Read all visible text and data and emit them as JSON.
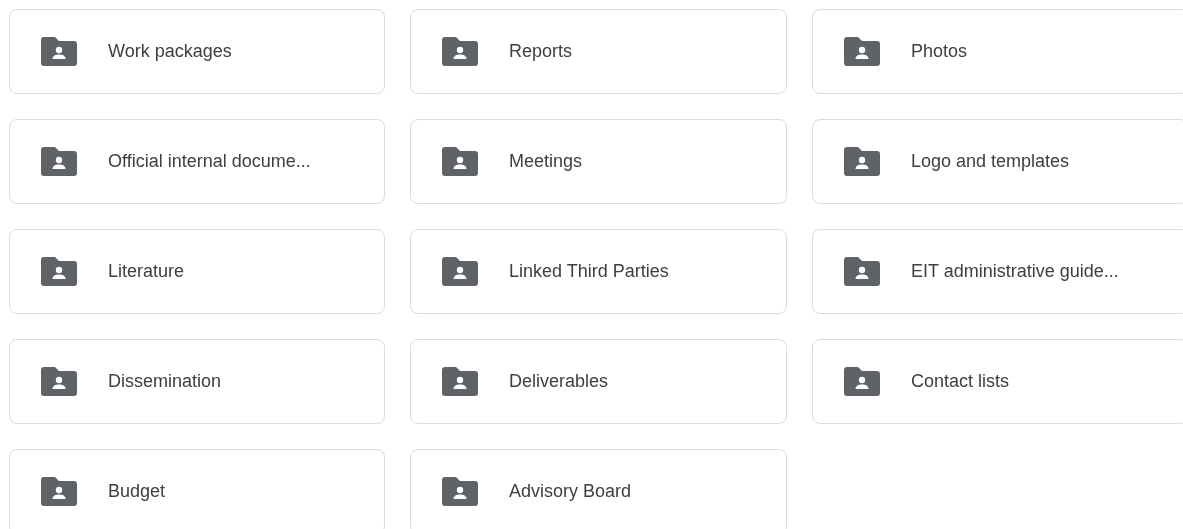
{
  "folders": [
    {
      "name": "Work packages"
    },
    {
      "name": "Reports"
    },
    {
      "name": "Photos"
    },
    {
      "name": "Official internal docume..."
    },
    {
      "name": "Meetings"
    },
    {
      "name": "Logo and templates"
    },
    {
      "name": "Literature"
    },
    {
      "name": "Linked Third Parties"
    },
    {
      "name": "EIT administrative guide..."
    },
    {
      "name": "Dissemination"
    },
    {
      "name": "Deliverables"
    },
    {
      "name": "Contact lists"
    },
    {
      "name": "Budget"
    },
    {
      "name": "Advisory Board"
    }
  ]
}
